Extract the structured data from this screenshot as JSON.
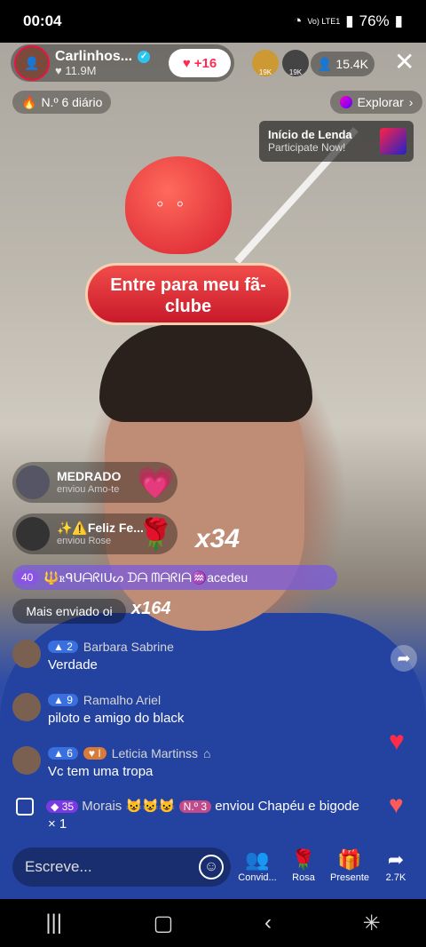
{
  "status": {
    "time": "00:04",
    "battery": "76%",
    "network": "Vo) LTE1"
  },
  "host": {
    "name": "Carlinhos...",
    "likes": "11.9M",
    "follow_label": "+16"
  },
  "viewers": {
    "count": "15.4K",
    "top1": "19K",
    "top2": "19K"
  },
  "rank": {
    "label": "N.º 6 diário"
  },
  "explore": {
    "label": "Explorar"
  },
  "legend_card": {
    "title": "Início de Lenda",
    "subtitle": "Participate Now!"
  },
  "fanclub": {
    "banner": "Entre para meu fã-clube"
  },
  "gifts": [
    {
      "name": "MEDRADO",
      "sub": "enviou Amo-te"
    },
    {
      "name": "✨⚠️Feliz Fe...",
      "sub": "enviou Rose",
      "multiplier": "x34"
    }
  ],
  "join_bar": {
    "level": "40",
    "text": "🔱ꭱᑫᑌᗩᖇIᑌᔕ ᗪᗩ ᗰᗩᖇIᗩ♒acedeu"
  },
  "more_sent": {
    "label": "Mais enviado oi",
    "multiplier": "x164"
  },
  "comments": [
    {
      "level": "2",
      "name": "Barbara Sabrine",
      "text": "Verdade"
    },
    {
      "level": "9",
      "name": "Ramalho Ariel",
      "text": "piloto e amigo do black"
    },
    {
      "level": "6",
      "fan_level": "I",
      "name": "Leticia Martinss",
      "text": "Vc tem uma tropa"
    }
  ],
  "gift_comment": {
    "level": "35",
    "name": "Morais",
    "rank": "N.º 3",
    "text": "enviou Chapéu e bigode",
    "count": "× 1"
  },
  "bottom": {
    "placeholder": "Escreve...",
    "actions": [
      {
        "label": "Convid...",
        "icon": "people-icon"
      },
      {
        "label": "Rosa",
        "icon": "rose-icon"
      },
      {
        "label": "Presente",
        "icon": "gift-icon"
      },
      {
        "label": "2.7K",
        "icon": "share-icon"
      }
    ]
  }
}
